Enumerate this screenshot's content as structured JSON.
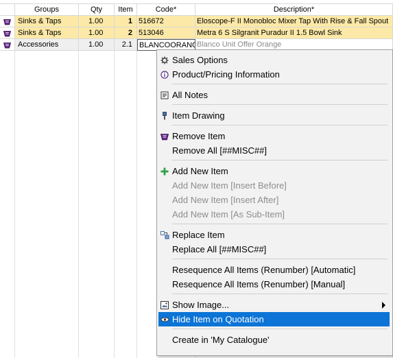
{
  "columns": [
    "Groups",
    "Qty",
    "Item",
    "Code*",
    "Description*"
  ],
  "rows": [
    {
      "group": "Sinks & Taps",
      "qty": "1.00",
      "item": "1",
      "code": "516672",
      "description": "Eloscope-F II Monobloc Mixer Tap With Rise & Fall Spout"
    },
    {
      "group": "Sinks & Taps",
      "qty": "1.00",
      "item": "2",
      "code": "513046",
      "description": "Metra 6 S Silgranit Puradur II 1.5 Bowl Sink"
    },
    {
      "group": "Accessories",
      "qty": "1.00",
      "item": "2.1",
      "code": "BLANCOORANGE",
      "description": "Blanco Unit Offer Orange"
    }
  ],
  "menu": {
    "sales_options": "Sales Options",
    "product_info": "Product/Pricing Information",
    "all_notes": "All Notes",
    "item_drawing": "Item Drawing",
    "remove_item": "Remove Item",
    "remove_all": "Remove All [##MISC##]",
    "add_new_item": "Add New Item",
    "add_before": "Add New Item [Insert Before]",
    "add_after": "Add New Item [Insert After]",
    "add_sub": "Add New Item [As Sub-Item]",
    "replace_item": "Replace Item",
    "replace_all": "Replace All [##MISC##]",
    "reseq_auto": "Resequence All Items (Renumber) [Automatic]",
    "reseq_manual": "Resequence All Items (Renumber) [Manual]",
    "show_image": "Show Image...",
    "hide_item": "Hide Item on Quotation",
    "create_catalogue": "Create in 'My Catalogue'"
  },
  "colors": {
    "row_highlight": "#fde9a7",
    "menu_active": "#0c74d6",
    "menu_bg": "#f2f2f2",
    "add_icon": "#2ea043"
  }
}
